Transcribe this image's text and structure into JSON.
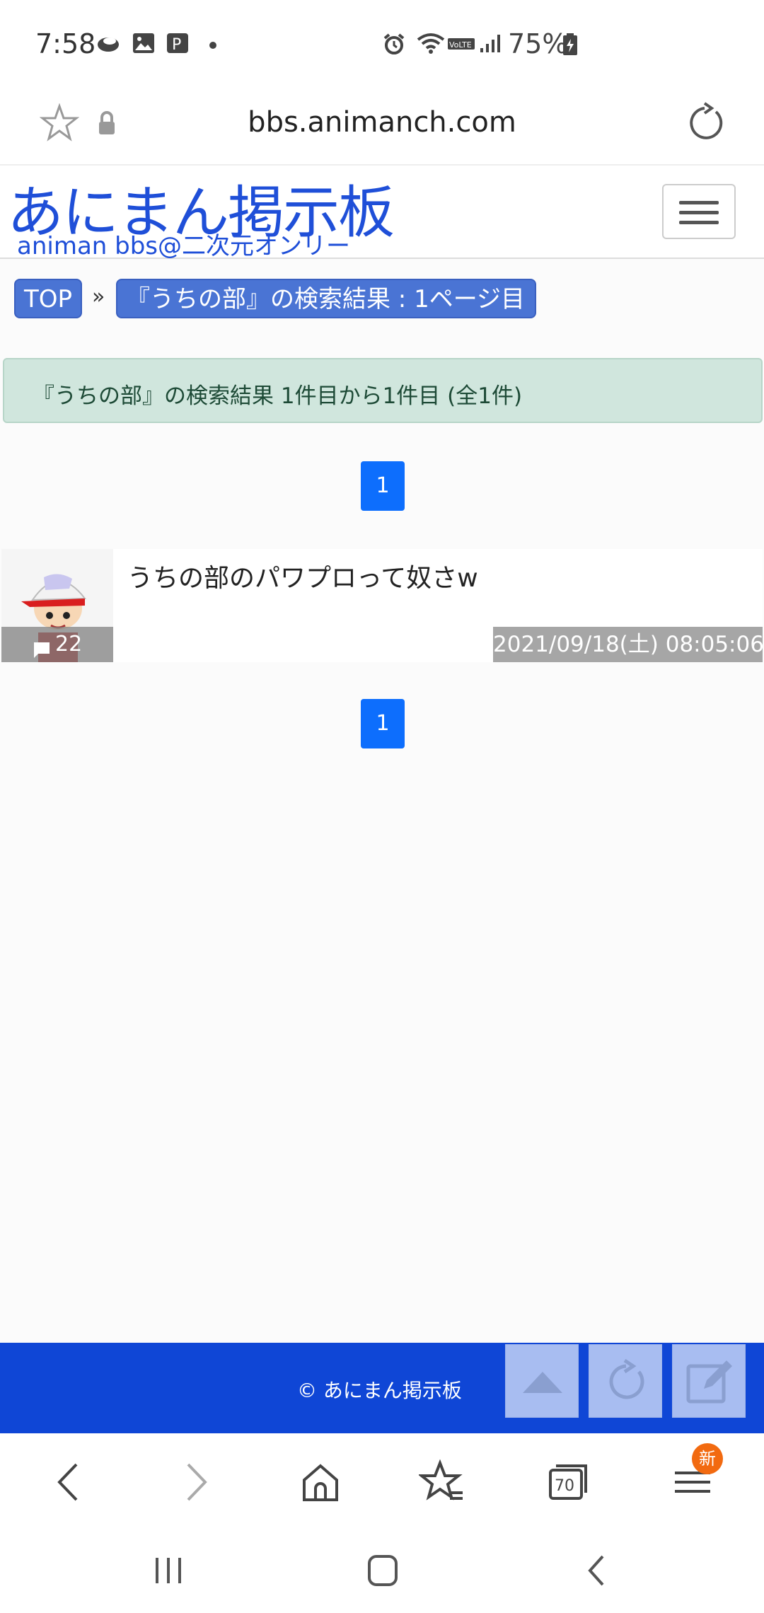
{
  "status_bar": {
    "time": "7:58",
    "battery": "75%",
    "left_icons": [
      "cloud-icon",
      "image-icon",
      "p-icon",
      "dot-icon"
    ],
    "right_icons": [
      "alarm-icon",
      "wifi-icon",
      "volte-icon",
      "signal-icon",
      "battery-charging-icon"
    ]
  },
  "address_bar": {
    "url": "bbs.animanch.com"
  },
  "site": {
    "logo_main": "あにまん掲示板",
    "logo_sub": "animan bbs@二次元オンリー"
  },
  "breadcrumb": {
    "top_label": "TOP",
    "separator": "»",
    "current_label": "『うちの部』の検索結果 : 1ページ目"
  },
  "search": {
    "result_summary": "『うちの部』の検索結果 1件目から1件目 (全1件)"
  },
  "pagination": {
    "top_page": "1",
    "bottom_page": "1"
  },
  "threads": [
    {
      "title": "うちの部のパワプロって奴さw",
      "comment_count": "22",
      "date": "2021/09/18(土) 08:05:06"
    }
  ],
  "footer": {
    "copyright": "© あにまん掲示板"
  },
  "toolbar": {
    "tab_count": "70",
    "menu_badge": "新"
  },
  "colors": {
    "brand_blue": "#1f4fd8",
    "footer_blue": "#0f46d6",
    "pagination_blue": "#0d6efd",
    "alert_green": "#d0e6dd"
  }
}
